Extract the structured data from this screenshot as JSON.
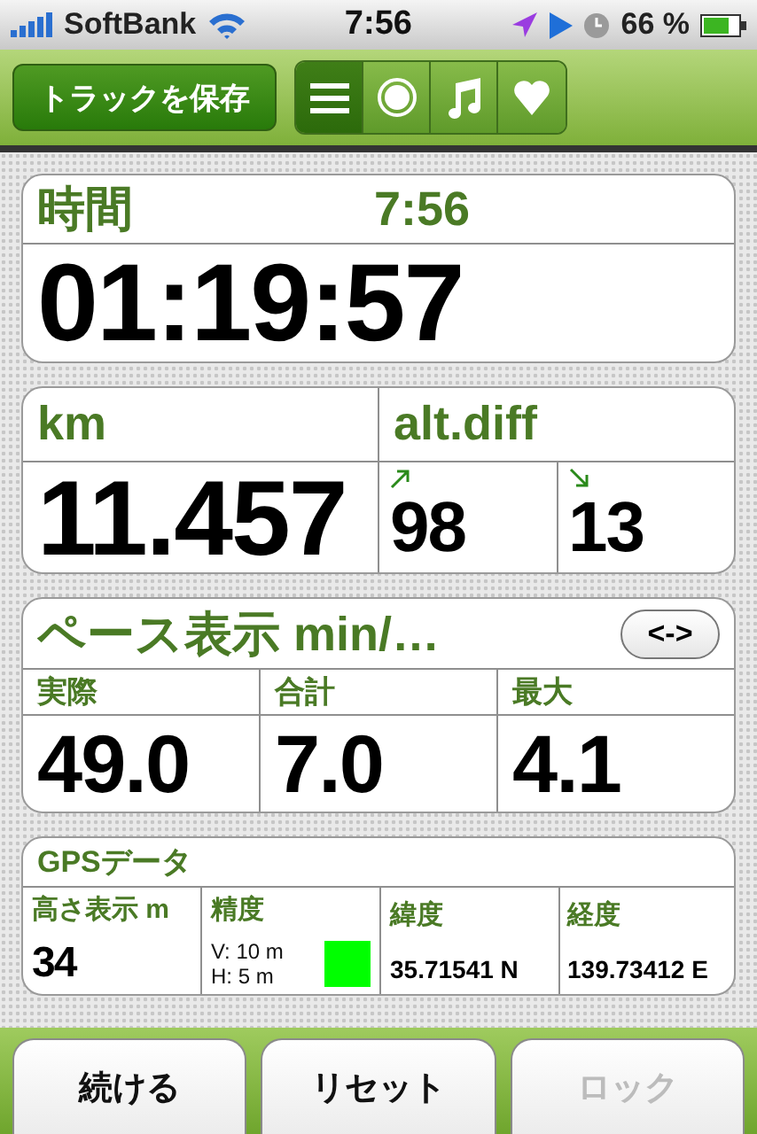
{
  "status_bar": {
    "carrier": "SoftBank",
    "time": "7:56",
    "battery": "66 %"
  },
  "toolbar": {
    "save_button": "トラックを保存",
    "segments": [
      {
        "kind": "list",
        "selected": true
      },
      {
        "kind": "record",
        "selected": false
      },
      {
        "kind": "music",
        "selected": false
      },
      {
        "kind": "heart",
        "selected": false
      }
    ]
  },
  "time_card": {
    "label": "時間",
    "clock": "7:56",
    "value": "01:19:57"
  },
  "distance_card": {
    "label": "km",
    "value": "11.457"
  },
  "altitude_card": {
    "label": "alt.diff",
    "up": "98",
    "down": "13"
  },
  "pace_card": {
    "title": "ペース表示 min/…",
    "toggle": "<->",
    "columns": [
      {
        "label": "実際",
        "value": "49.0"
      },
      {
        "label": "合計",
        "value": "7.0"
      },
      {
        "label": "最大",
        "value": "4.1"
      }
    ]
  },
  "gps_card": {
    "title": "GPSデータ",
    "altitude": {
      "label": "高さ表示 m",
      "value": "34"
    },
    "accuracy": {
      "label": "精度",
      "vertical": "V: 10 m",
      "horizontal": "H: 5 m",
      "color": "#00ff00"
    },
    "latitude": {
      "label": "緯度",
      "value": "35.71541 N"
    },
    "longitude": {
      "label": "経度",
      "value": "139.73412 E"
    }
  },
  "buttons": [
    {
      "label": "続ける",
      "disabled": false
    },
    {
      "label": "リセット",
      "disabled": false
    },
    {
      "label": "ロック",
      "disabled": true
    }
  ]
}
